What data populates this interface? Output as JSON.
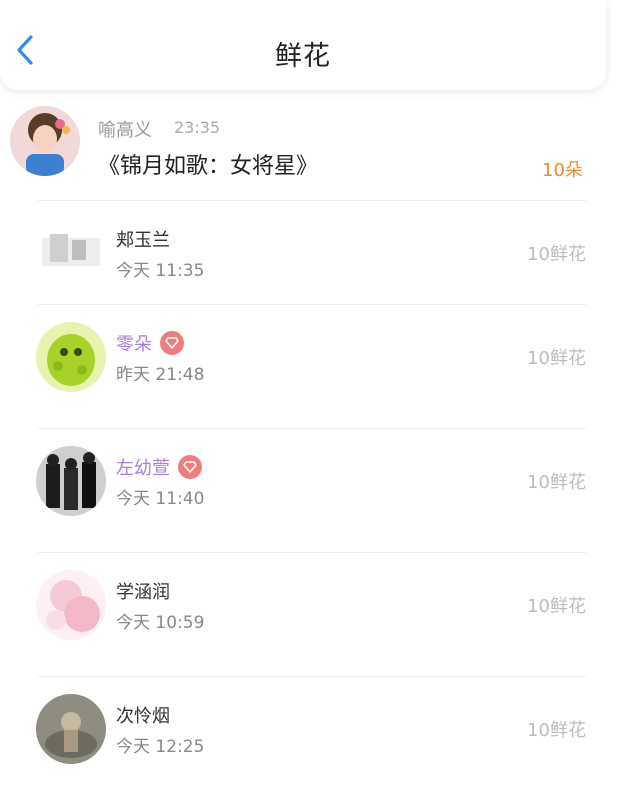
{
  "header": {
    "title": "鲜花",
    "back_icon": "chevron-left-icon"
  },
  "top_entry": {
    "name": "喻高义",
    "time": "23:35",
    "book": "《锦月如歌：女将星》",
    "count": "10朵"
  },
  "items": [
    {
      "name": "郏玉兰",
      "time": "今天 11:35",
      "amount": "10鲜花",
      "vip": false
    },
    {
      "name": "零朵",
      "time": "昨天 21:48",
      "amount": "10鲜花",
      "vip": true
    },
    {
      "name": "左幼萱",
      "time": "今天 11:40",
      "amount": "10鲜花",
      "vip": true
    },
    {
      "name": "学涵润",
      "time": "今天 10:59",
      "amount": "10鲜花",
      "vip": false
    },
    {
      "name": "次怜烟",
      "time": "今天 12:25",
      "amount": "10鲜花",
      "vip": false
    }
  ],
  "colors": {
    "accent_blue": "#2f8cf0",
    "count_orange": "#f08a24",
    "vip_purple": "#a97fd8",
    "badge_red": "#f07d7d"
  }
}
